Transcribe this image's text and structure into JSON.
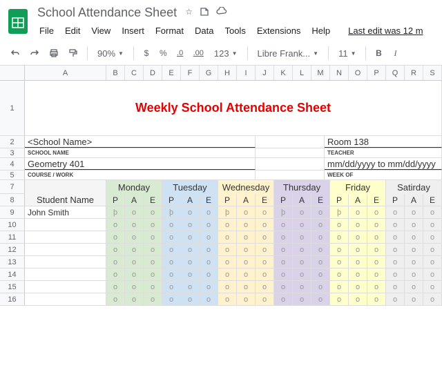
{
  "doc": {
    "title": "School Attendance Sheet",
    "last_edit": "Last edit was 12 m"
  },
  "menu": {
    "file": "File",
    "edit": "Edit",
    "view": "View",
    "insert": "Insert",
    "format": "Format",
    "data": "Data",
    "tools": "Tools",
    "extensions": "Extensions",
    "help": "Help"
  },
  "toolbar": {
    "zoom": "90%",
    "dollar": "$",
    "percent": "%",
    "dec1": ".0",
    "dec2": ".00",
    "fmt": "123",
    "font": "Libre Frank...",
    "size": "11",
    "bold": "B",
    "italic": "I"
  },
  "cols": [
    "A",
    "B",
    "C",
    "D",
    "E",
    "F",
    "G",
    "H",
    "I",
    "J",
    "K",
    "L",
    "M",
    "N",
    "O",
    "P",
    "Q",
    "R",
    "S"
  ],
  "rows": [
    "1",
    "2",
    "3",
    "4",
    "5",
    "7",
    "8",
    "9",
    "10",
    "11",
    "12",
    "13",
    "14",
    "15",
    "16"
  ],
  "sheet": {
    "title": "Weekly School Attendance Sheet",
    "school_val": "<School Name>",
    "school_lbl": "SCHOOL NAME",
    "room_val": "Room 138",
    "room_lbl": "TEACHER",
    "course_val": "Geometry 401",
    "course_lbl": "COURSE / WORK",
    "week_val": "mm/dd/yyyy to mm/dd/yyyy",
    "week_lbl": "WEEK OF",
    "student_hdr": "Student Name",
    "days": [
      "Monday",
      "Tuesday",
      "Wednesday",
      "Thursday",
      "Friday",
      "Satirday"
    ],
    "pae": [
      "P",
      "A",
      "E"
    ],
    "students": [
      "John Smith",
      "",
      "",
      "",
      "",
      "",
      "",
      ""
    ],
    "mark_p": "þ",
    "mark_o": "o"
  },
  "chart_data": {
    "type": "table",
    "title": "Weekly School Attendance Sheet",
    "columns": [
      "Student Name",
      "Mon P",
      "Mon A",
      "Mon E",
      "Tue P",
      "Tue A",
      "Tue E",
      "Wed P",
      "Wed A",
      "Wed E",
      "Thu P",
      "Thu A",
      "Thu E",
      "Fri P",
      "Fri A",
      "Fri E",
      "Sat P",
      "Sat A",
      "Sat E"
    ],
    "rows": [
      [
        "John Smith",
        "þ",
        "o",
        "o",
        "þ",
        "o",
        "o",
        "þ",
        "o",
        "o",
        "þ",
        "o",
        "o",
        "þ",
        "o",
        "o",
        "o",
        "o",
        "o"
      ],
      [
        "",
        "o",
        "o",
        "o",
        "o",
        "o",
        "o",
        "o",
        "o",
        "o",
        "o",
        "o",
        "o",
        "o",
        "o",
        "o",
        "o",
        "o",
        "o"
      ],
      [
        "",
        "o",
        "o",
        "o",
        "o",
        "o",
        "o",
        "o",
        "o",
        "o",
        "o",
        "o",
        "o",
        "o",
        "o",
        "o",
        "o",
        "o",
        "o"
      ],
      [
        "",
        "o",
        "o",
        "o",
        "o",
        "o",
        "o",
        "o",
        "o",
        "o",
        "o",
        "o",
        "o",
        "o",
        "o",
        "o",
        "o",
        "o",
        "o"
      ],
      [
        "",
        "o",
        "o",
        "o",
        "o",
        "o",
        "o",
        "o",
        "o",
        "o",
        "o",
        "o",
        "o",
        "o",
        "o",
        "o",
        "o",
        "o",
        "o"
      ],
      [
        "",
        "o",
        "o",
        "o",
        "o",
        "o",
        "o",
        "o",
        "o",
        "o",
        "o",
        "o",
        "o",
        "o",
        "o",
        "o",
        "o",
        "o",
        "o"
      ],
      [
        "",
        "o",
        "o",
        "o",
        "o",
        "o",
        "o",
        "o",
        "o",
        "o",
        "o",
        "o",
        "o",
        "o",
        "o",
        "o",
        "o",
        "o",
        "o"
      ],
      [
        "",
        "o",
        "o",
        "o",
        "o",
        "o",
        "o",
        "o",
        "o",
        "o",
        "o",
        "o",
        "o",
        "o",
        "o",
        "o",
        "o",
        "o",
        "o"
      ]
    ]
  }
}
